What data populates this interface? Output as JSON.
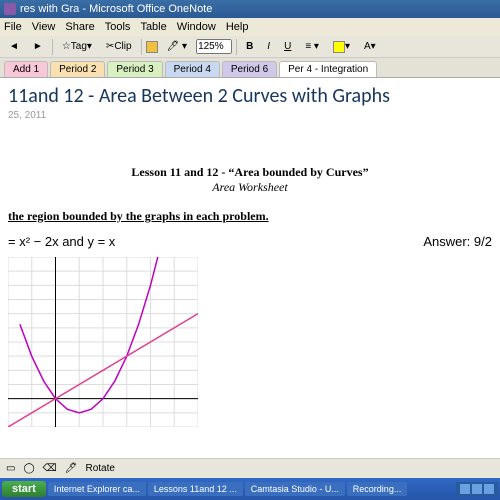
{
  "window": {
    "title": "res with Gra - Microsoft Office OneNote"
  },
  "menu": {
    "file": "File",
    "view": "View",
    "share": "Share",
    "tools": "Tools",
    "table": "Table",
    "window": "Window",
    "help": "Help"
  },
  "toolbar": {
    "tag": "Tag",
    "clip": "Clip",
    "zoom": "125%",
    "rotate": "Rotate"
  },
  "tabs": {
    "items": [
      {
        "label": "Add 1"
      },
      {
        "label": "Period 2"
      },
      {
        "label": "Period 3"
      },
      {
        "label": "Period 4"
      },
      {
        "label": "Period 6"
      }
    ],
    "active": "Per 4 - Integration"
  },
  "page": {
    "title": "11and 12  - Area Between 2 Curves with Graphs",
    "date": "25, 2011"
  },
  "doc": {
    "heading": "Lesson 11 and 12  - “Area bounded by Curves”",
    "sub": "Area Worksheet",
    "instruction": "the region bounded by the graphs in each problem.",
    "equation": "= x² − 2x and y = x",
    "answer_label": "Answer:",
    "answer_value": "9/2"
  },
  "taskbar": {
    "start": "start",
    "items": [
      {
        "label": "Internet Explorer ca..."
      },
      {
        "label": "Lessons 11and 12 ..."
      },
      {
        "label": "Camtasia Studio - U..."
      },
      {
        "label": "Recording..."
      }
    ]
  },
  "chart_data": {
    "type": "line",
    "title": "",
    "xlabel": "",
    "ylabel": "",
    "xlim": [
      -2,
      6
    ],
    "ylim": [
      -2,
      10
    ],
    "series": [
      {
        "name": "y = x^2 - 2x",
        "color": "#c000c0",
        "x": [
          -1.5,
          -1,
          -0.5,
          0,
          0.5,
          1,
          1.5,
          2,
          2.5,
          3,
          3.5,
          4,
          4.5
        ],
        "y": [
          5.25,
          3,
          1.25,
          0,
          -0.75,
          -1,
          -0.75,
          0,
          1.25,
          3,
          5.25,
          8,
          11.25
        ]
      },
      {
        "name": "y = x",
        "color": "#e04090",
        "x": [
          -2,
          6
        ],
        "y": [
          -2,
          6
        ]
      }
    ]
  }
}
